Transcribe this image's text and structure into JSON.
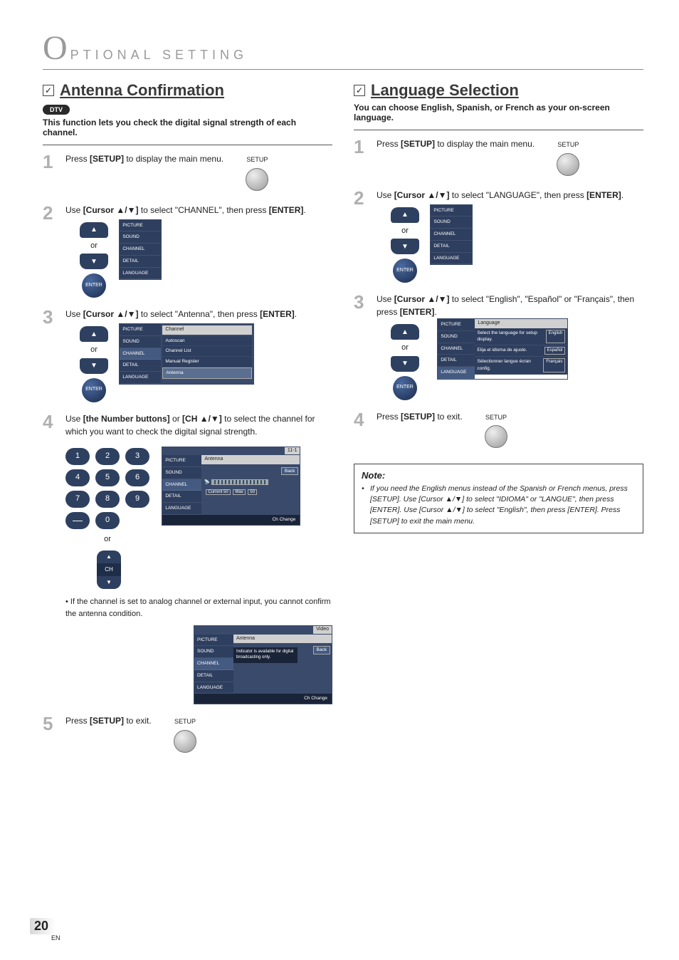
{
  "heading_prefix": "O",
  "heading": "PTIONAL   SETTING",
  "page_number": "20",
  "page_lang": "EN",
  "checkmark": "✓",
  "left": {
    "title": "Antenna Confirmation",
    "dtv": "DTV",
    "intro": "This function lets you check the digital signal strength of each channel.",
    "step1": {
      "num": "1",
      "text_a": "Press ",
      "text_b": "[SETUP]",
      "text_c": " to display the main menu.",
      "setup_label": "SETUP"
    },
    "step2": {
      "num": "2",
      "text_a": "Use ",
      "text_b": "[Cursor ▲/▼]",
      "text_c": " to select \"CHANNEL\", then press ",
      "text_d": "[ENTER]",
      "text_e": ".",
      "or": "or",
      "enter": "ENTER"
    },
    "step3": {
      "num": "3",
      "text_a": "Use ",
      "text_b": "[Cursor ▲/▼]",
      "text_c": " to select \"Antenna\", then press ",
      "text_d": "[ENTER]",
      "text_e": ".",
      "or": "or",
      "enter": "ENTER"
    },
    "step4": {
      "num": "4",
      "text_a": "Use ",
      "text_b": "[the Number buttons]",
      "text_c": " or ",
      "text_d": "[CH ▲/▼]",
      "text_e": " to select the channel for which you want to check the digital signal strength.",
      "or": "or",
      "ch": "CH"
    },
    "step4_note": "If the channel is set to analog channel or external input, you cannot confirm the antenna condition.",
    "step5": {
      "num": "5",
      "text_a": "Press ",
      "text_b": "[SETUP]",
      "text_c": " to exit.",
      "setup_label": "SETUP"
    },
    "osd_menu": {
      "items": [
        "PICTURE",
        "SOUND",
        "CHANNEL",
        "DETAIL",
        "LANGUAGE"
      ]
    },
    "osd_channel": {
      "title": "Channel",
      "items": [
        "Autoscan",
        "Channel List",
        "Manual Register",
        "Antenna"
      ]
    },
    "osd_antenna": {
      "tag": "11-1",
      "title": "Antenna",
      "back": "Back",
      "current_label": "Current 50",
      "max_label": "Max",
      "max_val": "50",
      "footer": "Ch Change"
    },
    "osd_antenna_video": {
      "tag": "Video",
      "title": "Antenna",
      "back": "Back",
      "msg": "Indicator is available for digital broadcasting only.",
      "footer": "Ch Change"
    },
    "keypad": [
      [
        "1",
        "2",
        "3"
      ],
      [
        "4",
        "5",
        "6"
      ],
      [
        "7",
        "8",
        "9"
      ],
      [
        "—",
        "0",
        ""
      ]
    ]
  },
  "right": {
    "title": "Language Selection",
    "intro": "You can choose English, Spanish, or French as your on-screen language.",
    "step1": {
      "num": "1",
      "text_a": "Press ",
      "text_b": "[SETUP]",
      "text_c": " to display the main menu.",
      "setup_label": "SETUP"
    },
    "step2": {
      "num": "2",
      "text_a": "Use ",
      "text_b": "[Cursor ▲/▼]",
      "text_c": " to select \"LANGUAGE\", then press ",
      "text_d": "[ENTER]",
      "text_e": ".",
      "or": "or",
      "enter": "ENTER"
    },
    "step3": {
      "num": "3",
      "text_a": "Use ",
      "text_b": "[Cursor ▲/▼]",
      "text_c": " to select \"English\", \"Español\" or \"Français\", then press ",
      "text_d": "[ENTER]",
      "text_e": ".",
      "or": "or",
      "enter": "ENTER"
    },
    "step4": {
      "num": "4",
      "text_a": "Press ",
      "text_b": "[SETUP]",
      "text_c": " to exit.",
      "setup_label": "SETUP"
    },
    "osd_menu": {
      "items": [
        "PICTURE",
        "SOUND",
        "CHANNEL",
        "DETAIL",
        "LANGUAGE"
      ]
    },
    "osd_lang": {
      "title": "Language",
      "rows": [
        {
          "label": "Select the language for setup display.",
          "opt": "English"
        },
        {
          "label": "Elija el idioma de ajuste.",
          "opt": "Español"
        },
        {
          "label": "Sélectionner langue écran config.",
          "opt": "Français"
        }
      ]
    },
    "note": {
      "title": "Note:",
      "body": "If you need the English menus instead of the Spanish or French menus, press [SETUP]. Use [Cursor ▲/▼] to select \"IDIOMA\" or \"LANGUE\", then press [ENTER]. Use [Cursor ▲/▼] to select \"English\", then press [ENTER]. Press [SETUP] to exit the main menu."
    }
  }
}
